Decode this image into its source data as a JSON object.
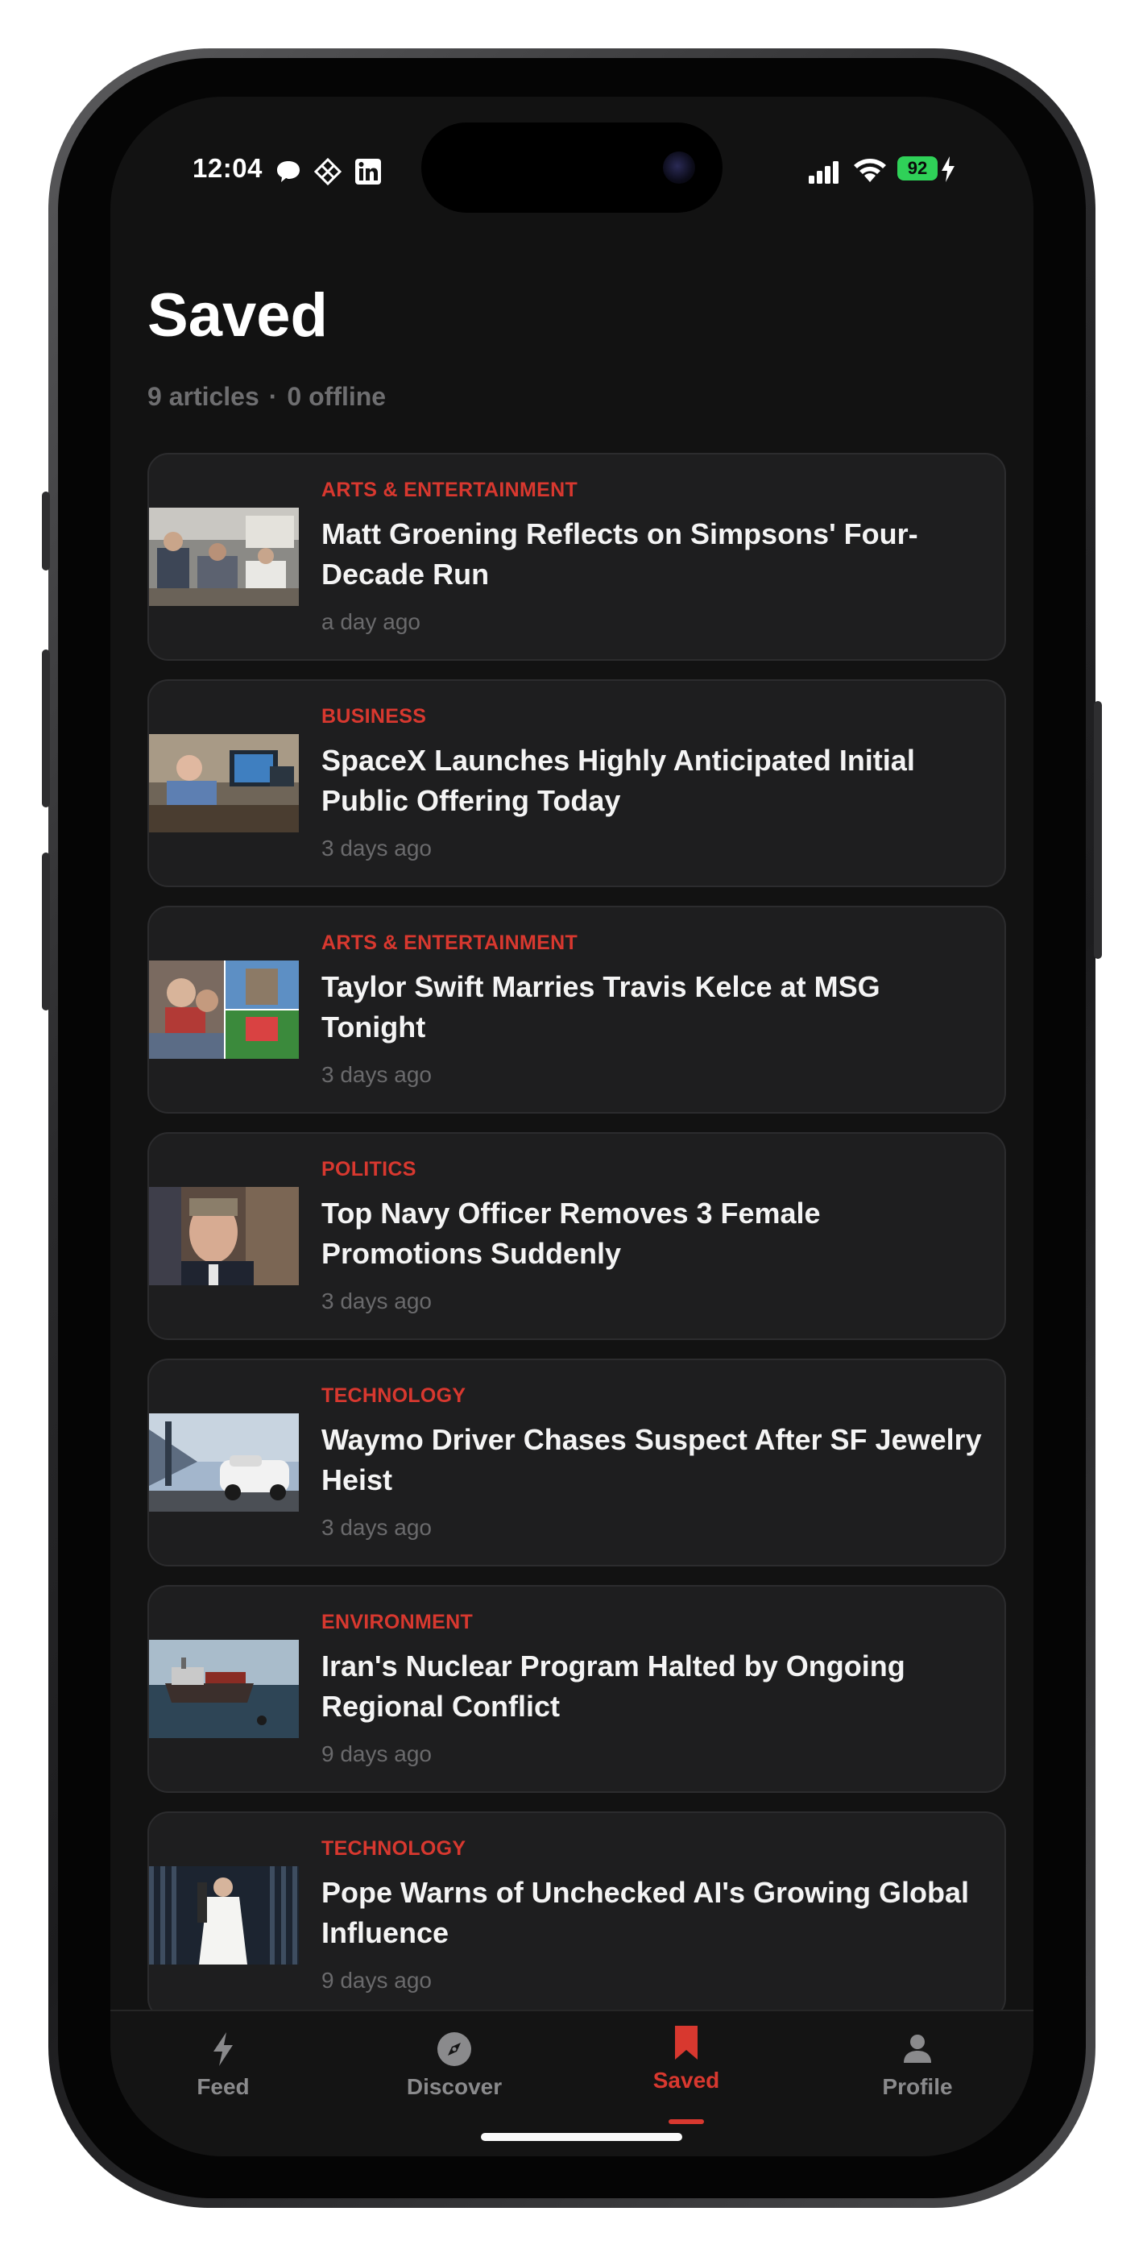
{
  "status_bar": {
    "time": "12:04",
    "battery": "92",
    "icons_left": [
      "message-bubble-icon",
      "diamond-grid-icon",
      "linkedin-icon"
    ],
    "icons_right": [
      "cellular-signal-icon",
      "wifi-icon",
      "battery-icon",
      "charging-bolt-icon"
    ]
  },
  "header": {
    "title": "Saved",
    "article_count": "9 articles",
    "separator": "·",
    "offline_count": "0 offline"
  },
  "articles": [
    {
      "category": "ARTS & ENTERTAINMENT",
      "headline": "Matt Groening Reflects on Simpsons' Four-Decade Run",
      "age": "a day ago",
      "thumb": "airplane-cabin-photo"
    },
    {
      "category": "BUSINESS",
      "headline": "SpaceX Launches Highly Anticipated Initial Public Offering Today",
      "age": "3 days ago",
      "thumb": "office-desk-photo"
    },
    {
      "category": "ARTS & ENTERTAINMENT",
      "headline": "Taylor Swift Marries Travis Kelce at MSG Tonight",
      "age": "3 days ago",
      "thumb": "collage-photo"
    },
    {
      "category": "POLITICS",
      "headline": "Top Navy Officer Removes 3 Female Promotions Suddenly",
      "age": "3 days ago",
      "thumb": "portrait-photo"
    },
    {
      "category": "TECHNOLOGY",
      "headline": "Waymo Driver Chases Suspect After SF Jewelry Heist",
      "age": "3 days ago",
      "thumb": "self-driving-car-photo"
    },
    {
      "category": "ENVIRONMENT",
      "headline": "Iran's Nuclear Program Halted by Ongoing Regional Conflict",
      "age": "9 days ago",
      "thumb": "tanker-ship-photo"
    },
    {
      "category": "TECHNOLOGY",
      "headline": "Pope Warns of Unchecked AI's Growing Global Influence",
      "age": "9 days ago",
      "thumb": "pope-photo"
    }
  ],
  "tabs": [
    {
      "label": "Feed",
      "icon": "lightning-icon",
      "active": false
    },
    {
      "label": "Discover",
      "icon": "compass-icon",
      "active": false
    },
    {
      "label": "Saved",
      "icon": "bookmark-icon",
      "active": true
    },
    {
      "label": "Profile",
      "icon": "person-icon",
      "active": false
    }
  ],
  "colors": {
    "accent": "#d8382f",
    "background": "#121212",
    "card": "#1e1e1f",
    "battery": "#2fd158"
  }
}
